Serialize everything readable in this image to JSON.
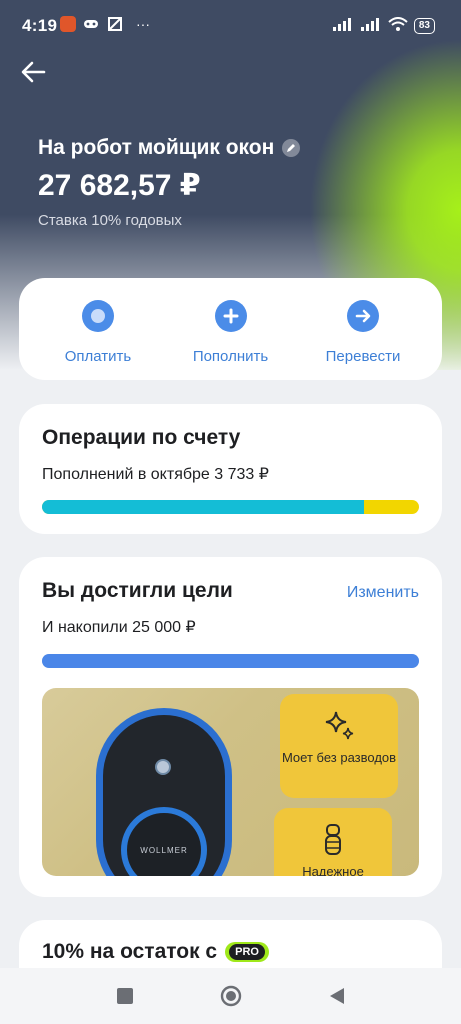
{
  "status_bar": {
    "time": "4:19",
    "more": "···",
    "battery": "83",
    "icons": [
      "game-controller-icon",
      "app-icon",
      "signal-icon",
      "signal-icon",
      "wifi-icon",
      "battery-icon"
    ]
  },
  "header": {
    "title": "На робот мойщик окон",
    "amount": "27 682,57 ₽",
    "rate": "Ставка 10% годовых"
  },
  "actions": [
    {
      "label": "Оплатить",
      "icon": "pay-icon"
    },
    {
      "label": "Пополнить",
      "icon": "plus-icon"
    },
    {
      "label": "Перевести",
      "icon": "arrow-right-icon"
    }
  ],
  "operations": {
    "title": "Операции по счету",
    "subtitle": "Пополнений в октябре 3 733 ₽",
    "bar_fraction": 0.855,
    "colors": {
      "primary": "#14bdd6",
      "secondary": "#f2d600"
    }
  },
  "goal": {
    "title": "Вы достигли цели",
    "change_label": "Изменить",
    "subtitle": "И накопили 25 000 ₽",
    "progress_fraction": 1.0,
    "promo": {
      "brand": "WOLLMER",
      "feature1": "Моет без разводов",
      "feature2": "Надежное"
    }
  },
  "bonus": {
    "title": "10% на остаток с",
    "badge": "PRO"
  },
  "navbar": {
    "items": [
      "recents-icon",
      "home-icon",
      "back-icon"
    ]
  }
}
